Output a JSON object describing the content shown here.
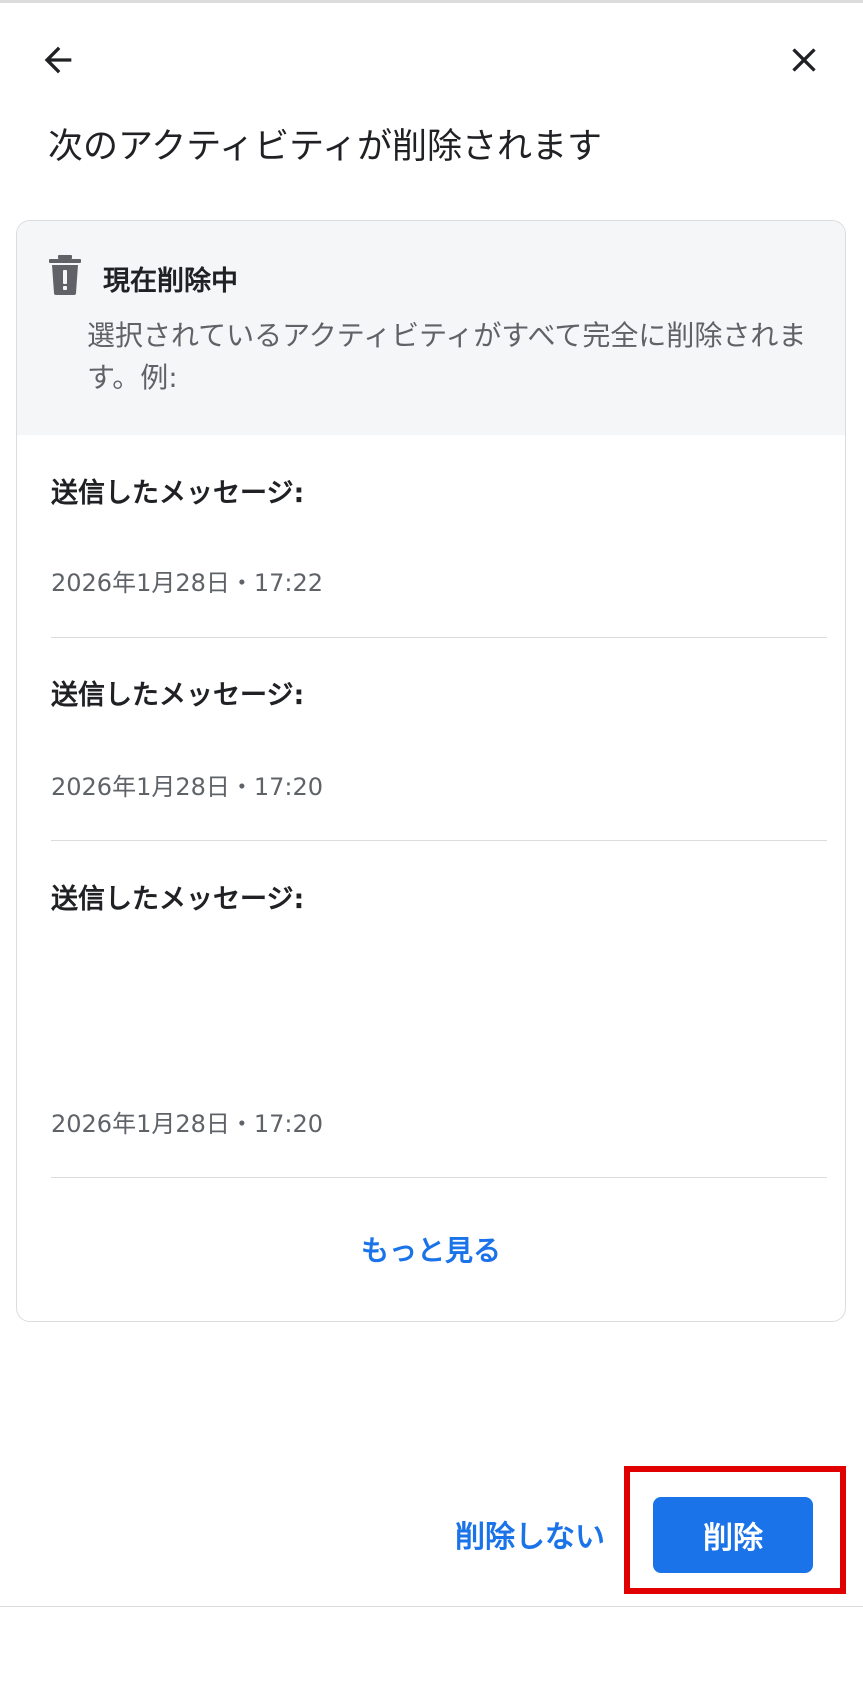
{
  "header": {
    "back_icon": "arrow-back-icon",
    "close_icon": "close-icon",
    "title": "次のアクティビティが削除されます"
  },
  "card": {
    "icon": "trash-alert-icon",
    "head_title": "現在削除中",
    "head_desc": "選択されているアクティビティがすべて完全に削除されます。例:",
    "items": [
      {
        "label": "送信したメッセージ:",
        "date": "2026年1月28日・17:22"
      },
      {
        "label": "送信したメッセージ:",
        "date": "2026年1月28日・17:20"
      },
      {
        "label": "送信したメッセージ:",
        "date": "2026年1月28日・17:20"
      }
    ],
    "see_more": "もっと見る"
  },
  "actions": {
    "cancel_label": "削除しない",
    "delete_label": "削除"
  },
  "colors": {
    "accent": "#1a73e8",
    "highlight": "#e00000"
  }
}
